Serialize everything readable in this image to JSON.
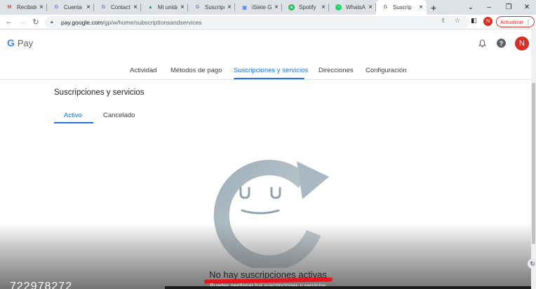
{
  "browser": {
    "tabs": [
      {
        "title": "Recibido",
        "favicon": "gmail-icon",
        "color": "#ea4335",
        "glyph": "M"
      },
      {
        "title": "Cuenta d",
        "favicon": "google-icon",
        "color": "#4285f4",
        "glyph": "G"
      },
      {
        "title": "Contacto",
        "favicon": "google-icon",
        "color": "#4285f4",
        "glyph": "G"
      },
      {
        "title": "Mi unidad",
        "favicon": "drive-icon",
        "color": "#0f9d58",
        "glyph": "▲"
      },
      {
        "title": "Suscripci",
        "favicon": "google-icon",
        "color": "#4285f4",
        "glyph": "G"
      },
      {
        "title": "iSiete Gr",
        "favicon": "site-icon",
        "color": "#1a73e8",
        "glyph": "▦"
      },
      {
        "title": "Spotify",
        "favicon": "spotify-icon",
        "color": "#1db954",
        "glyph": "≋"
      },
      {
        "title": "WhatsAp",
        "favicon": "whatsapp-icon",
        "color": "#25d366",
        "glyph": "◔"
      },
      {
        "title": "Suscrip",
        "favicon": "google-icon",
        "color": "#4285f4",
        "glyph": "G",
        "active": true
      }
    ],
    "url_host": "pay.google.com",
    "url_path": "/gp/w/home/subscriptionsandservices",
    "profile_initial": "N",
    "update_label": "Actualizar"
  },
  "app": {
    "logo_text": "Pay",
    "logo_g": "G",
    "user_initial": "N",
    "nav": [
      {
        "label": "Actividad"
      },
      {
        "label": "Métodos de pago"
      },
      {
        "label": "Suscripciones y servicios",
        "active": true
      },
      {
        "label": "Direcciones"
      },
      {
        "label": "Configuración"
      }
    ],
    "section_title": "Suscripciones y servicios",
    "subtabs": [
      {
        "label": "Activo",
        "active": true
      },
      {
        "label": "Cancelado"
      }
    ],
    "empty_title": "No hay suscripciones activas",
    "empty_subtitle": "Puedes gestionar tus suscripciones y servicios",
    "overlay_number": "722978272"
  },
  "colors": {
    "accent": "#1a73e8",
    "avatar": "#d93025",
    "annotation": "#e8141e"
  }
}
